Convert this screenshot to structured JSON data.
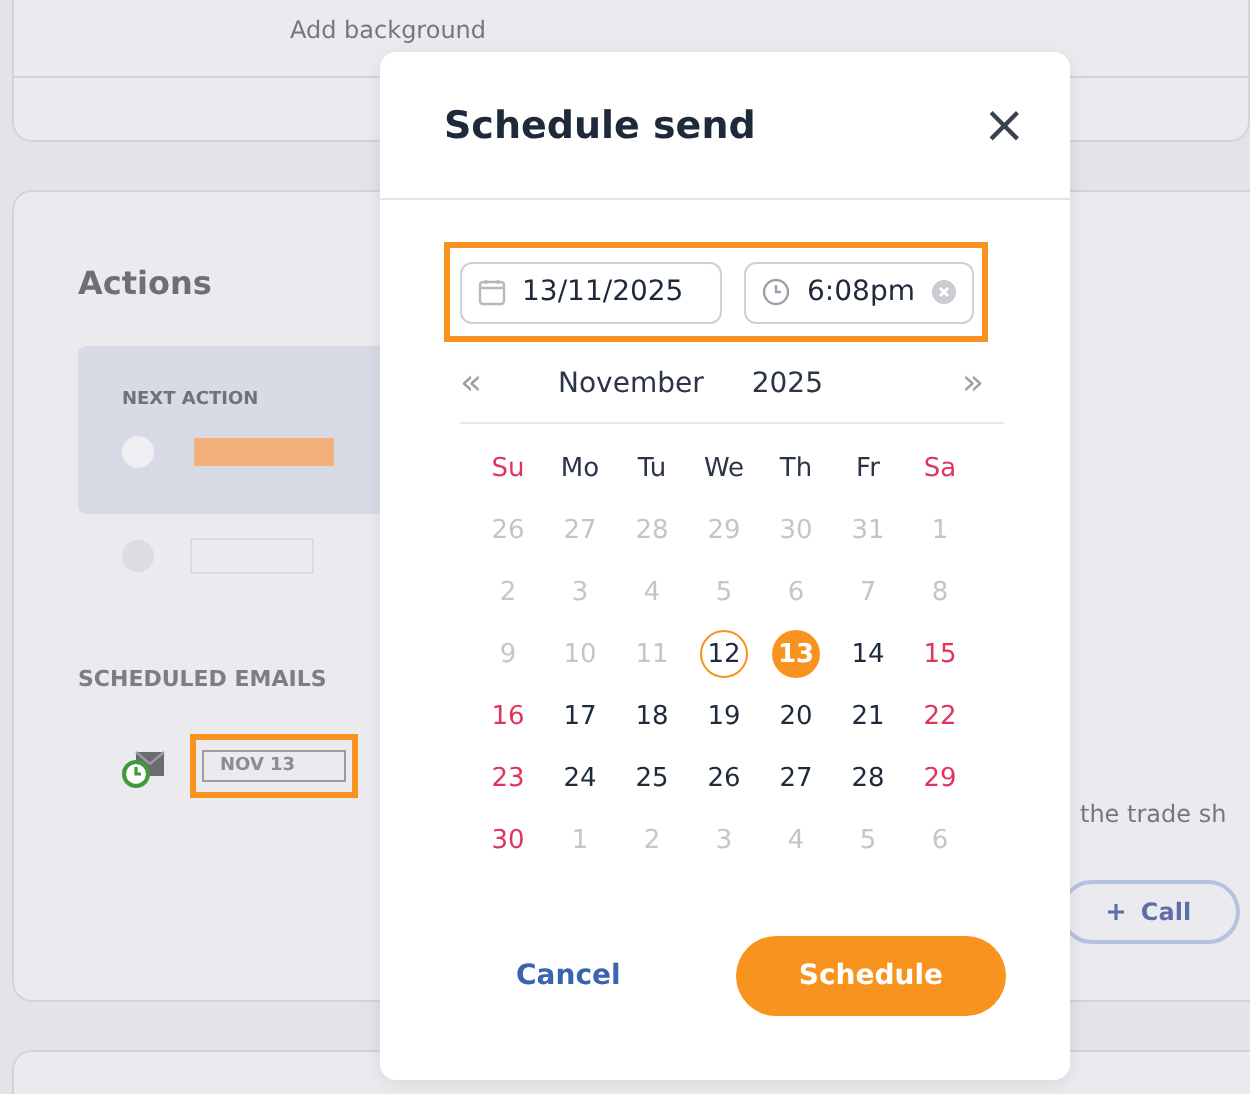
{
  "background": {
    "top_card": {
      "label": "Add background"
    },
    "actions_card": {
      "title": "Actions",
      "next_action": {
        "heading": "NEXT ACTION"
      },
      "scheduled": {
        "heading": "SCHEDULED EMAILS",
        "date_tag": "NOV 13"
      },
      "note": "the trade sh",
      "call_button": "Call"
    }
  },
  "dialog": {
    "title": "Schedule send",
    "close": "×",
    "date_field": {
      "value": "13/11/2025"
    },
    "time_field": {
      "value": "6:08pm"
    },
    "nav": {
      "prev": "«",
      "month": "November",
      "year": "2025",
      "next": "»"
    },
    "weekdays": [
      "Su",
      "Mo",
      "Tu",
      "We",
      "Th",
      "Fr",
      "Sa"
    ],
    "weeks": [
      [
        {
          "label": "26",
          "kind": "outside",
          "selected": false,
          "today": false
        },
        {
          "label": "27",
          "kind": "outside",
          "selected": false,
          "today": false
        },
        {
          "label": "28",
          "kind": "outside",
          "selected": false,
          "today": false
        },
        {
          "label": "29",
          "kind": "outside",
          "selected": false,
          "today": false
        },
        {
          "label": "30",
          "kind": "outside",
          "selected": false,
          "today": false
        },
        {
          "label": "31",
          "kind": "outside",
          "selected": false,
          "today": false
        },
        {
          "label": "1",
          "kind": "past",
          "selected": false,
          "today": false
        }
      ],
      [
        {
          "label": "2",
          "kind": "past",
          "selected": false,
          "today": false
        },
        {
          "label": "3",
          "kind": "past",
          "selected": false,
          "today": false
        },
        {
          "label": "4",
          "kind": "past",
          "selected": false,
          "today": false
        },
        {
          "label": "5",
          "kind": "past",
          "selected": false,
          "today": false
        },
        {
          "label": "6",
          "kind": "past",
          "selected": false,
          "today": false
        },
        {
          "label": "7",
          "kind": "past",
          "selected": false,
          "today": false
        },
        {
          "label": "8",
          "kind": "past",
          "selected": false,
          "today": false
        }
      ],
      [
        {
          "label": "9",
          "kind": "past",
          "selected": false,
          "today": false
        },
        {
          "label": "10",
          "kind": "past",
          "selected": false,
          "today": false
        },
        {
          "label": "11",
          "kind": "past",
          "selected": false,
          "today": false
        },
        {
          "label": "12",
          "kind": "current",
          "selected": false,
          "today": true
        },
        {
          "label": "13",
          "kind": "current",
          "selected": true,
          "today": false
        },
        {
          "label": "14",
          "kind": "current",
          "selected": false,
          "today": false
        },
        {
          "label": "15",
          "kind": "current",
          "selected": false,
          "today": false
        }
      ],
      [
        {
          "label": "16",
          "kind": "current",
          "selected": false,
          "today": false
        },
        {
          "label": "17",
          "kind": "current",
          "selected": false,
          "today": false
        },
        {
          "label": "18",
          "kind": "current",
          "selected": false,
          "today": false
        },
        {
          "label": "19",
          "kind": "current",
          "selected": false,
          "today": false
        },
        {
          "label": "20",
          "kind": "current",
          "selected": false,
          "today": false
        },
        {
          "label": "21",
          "kind": "current",
          "selected": false,
          "today": false
        },
        {
          "label": "22",
          "kind": "current",
          "selected": false,
          "today": false
        }
      ],
      [
        {
          "label": "23",
          "kind": "current",
          "selected": false,
          "today": false
        },
        {
          "label": "24",
          "kind": "current",
          "selected": false,
          "today": false
        },
        {
          "label": "25",
          "kind": "current",
          "selected": false,
          "today": false
        },
        {
          "label": "26",
          "kind": "current",
          "selected": false,
          "today": false
        },
        {
          "label": "27",
          "kind": "current",
          "selected": false,
          "today": false
        },
        {
          "label": "28",
          "kind": "current",
          "selected": false,
          "today": false
        },
        {
          "label": "29",
          "kind": "current",
          "selected": false,
          "today": false
        }
      ],
      [
        {
          "label": "30",
          "kind": "current",
          "selected": false,
          "today": false
        },
        {
          "label": "1",
          "kind": "outside",
          "selected": false,
          "today": false
        },
        {
          "label": "2",
          "kind": "outside",
          "selected": false,
          "today": false
        },
        {
          "label": "3",
          "kind": "outside",
          "selected": false,
          "today": false
        },
        {
          "label": "4",
          "kind": "outside",
          "selected": false,
          "today": false
        },
        {
          "label": "5",
          "kind": "outside",
          "selected": false,
          "today": false
        },
        {
          "label": "6",
          "kind": "outside",
          "selected": false,
          "today": false
        }
      ]
    ],
    "buttons": {
      "cancel": "Cancel",
      "schedule": "Schedule"
    }
  }
}
